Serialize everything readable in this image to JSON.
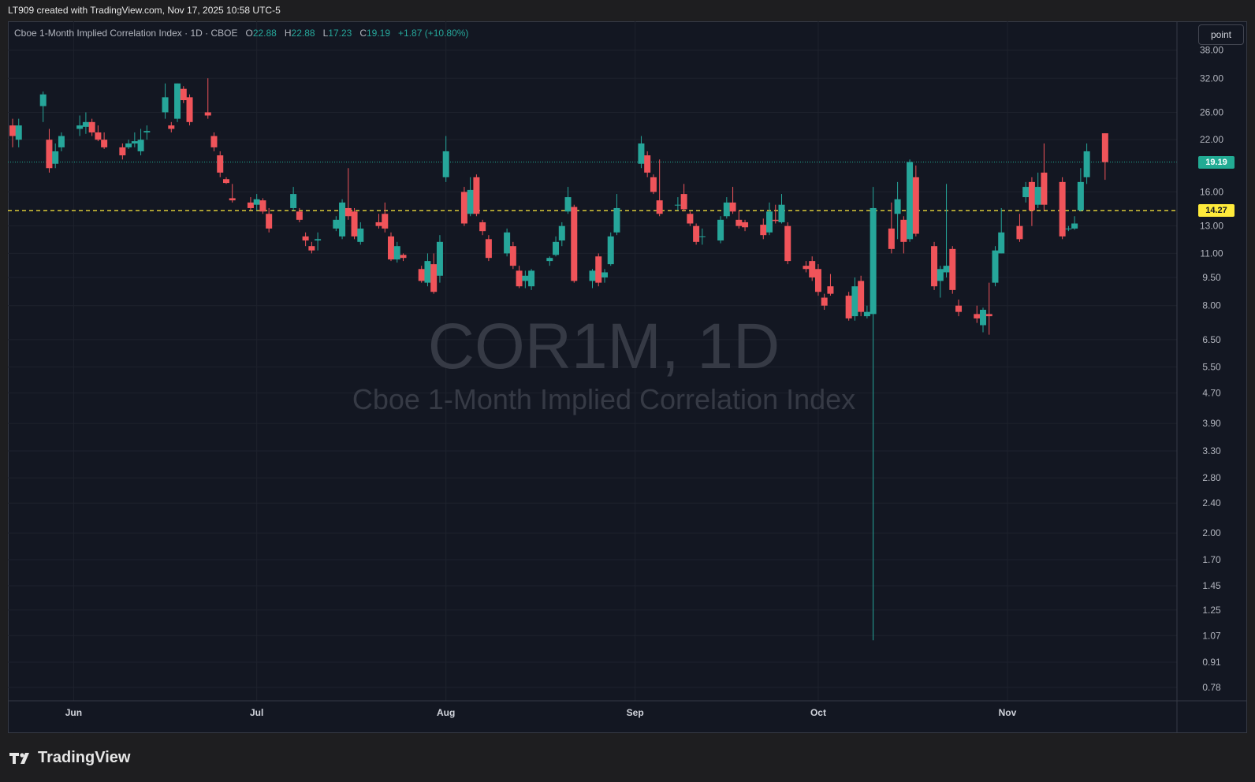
{
  "header": {
    "attribution": "LT909 created with TradingView.com, Nov 17, 2025 10:58 UTC-5"
  },
  "legend": {
    "title": "Cboe 1-Month Implied Correlation Index · 1D · CBOE",
    "open_label": "O",
    "open": "22.88",
    "high_label": "H",
    "high": "22.88",
    "low_label": "L",
    "low": "17.23",
    "close_label": "C",
    "close": "19.19",
    "change": "+1.87 (+10.80%)"
  },
  "toolbar": {
    "scale_button": "point"
  },
  "watermark": {
    "symbol": "COR1M, 1D",
    "description": "Cboe 1-Month Implied Correlation Index"
  },
  "brand": {
    "name": "TradingView",
    "logo_icon": "tradingview-logo-icon"
  },
  "price_tags": {
    "last": "19.19",
    "level": "14.27"
  },
  "colors": {
    "up": "#26a69a",
    "down": "#f0545a",
    "background": "#131722",
    "level_line": "#ffeb3b",
    "last_tag": "#22ab94"
  },
  "chart_data": {
    "type": "candlestick",
    "x_scale": "time",
    "y_scale": "log",
    "ylim": [
      0.74,
      44
    ],
    "xlim": [
      "2025-05-22",
      "2025-11-28"
    ],
    "y_ticks": [
      "38.00",
      "32.00",
      "26.00",
      "22.00",
      "16.00",
      "13.00",
      "11.00",
      "9.50",
      "8.00",
      "6.50",
      "5.50",
      "4.70",
      "3.90",
      "3.30",
      "2.80",
      "2.40",
      "2.00",
      "1.70",
      "1.45",
      "1.25",
      "1.07",
      "0.91",
      "0.78"
    ],
    "x_ticks": [
      {
        "date": "2025-06-01",
        "label": "Jun"
      },
      {
        "date": "2025-07-01",
        "label": "Jul"
      },
      {
        "date": "2025-08-01",
        "label": "Aug"
      },
      {
        "date": "2025-09-01",
        "label": "Sep"
      },
      {
        "date": "2025-10-01",
        "label": "Oct"
      },
      {
        "date": "2025-11-01",
        "label": "Nov"
      }
    ],
    "horizontal_line": 14.27,
    "last_price": 19.19,
    "candles": [
      {
        "d": "2025-05-22",
        "o": 24.0,
        "h": 25.0,
        "l": 21.0,
        "c": 22.5
      },
      {
        "d": "2025-05-23",
        "o": 22.0,
        "h": 25.0,
        "l": 21.0,
        "c": 24.0
      },
      {
        "d": "2025-05-27",
        "o": 27.0,
        "h": 29.5,
        "l": 24.5,
        "c": 29.0
      },
      {
        "d": "2025-05-28",
        "o": 22.0,
        "h": 23.5,
        "l": 18.0,
        "c": 18.5
      },
      {
        "d": "2025-05-29",
        "o": 19.0,
        "h": 21.5,
        "l": 18.5,
        "c": 20.5
      },
      {
        "d": "2025-05-30",
        "o": 21.0,
        "h": 23.0,
        "l": 20.5,
        "c": 22.5
      },
      {
        "d": "2025-06-02",
        "o": 23.5,
        "h": 25.5,
        "l": 22.5,
        "c": 24.0
      },
      {
        "d": "2025-06-03",
        "o": 23.8,
        "h": 26.0,
        "l": 22.8,
        "c": 24.5
      },
      {
        "d": "2025-06-04",
        "o": 24.5,
        "h": 25.0,
        "l": 22.5,
        "c": 23.0
      },
      {
        "d": "2025-06-05",
        "o": 23.0,
        "h": 24.0,
        "l": 21.8,
        "c": 22.0
      },
      {
        "d": "2025-06-06",
        "o": 22.0,
        "h": 23.0,
        "l": 20.8,
        "c": 21.0
      },
      {
        "d": "2025-06-09",
        "o": 21.0,
        "h": 21.5,
        "l": 19.5,
        "c": 20.0
      },
      {
        "d": "2025-06-10",
        "o": 21.0,
        "h": 22.0,
        "l": 20.8,
        "c": 21.5
      },
      {
        "d": "2025-06-11",
        "o": 21.5,
        "h": 23.0,
        "l": 21.0,
        "c": 21.8
      },
      {
        "d": "2025-06-12",
        "o": 20.5,
        "h": 23.5,
        "l": 20.0,
        "c": 22.0
      },
      {
        "d": "2025-06-13",
        "o": 23.0,
        "h": 24.0,
        "l": 22.0,
        "c": 23.2
      },
      {
        "d": "2025-06-16",
        "o": 26.0,
        "h": 31.0,
        "l": 25.0,
        "c": 28.5
      },
      {
        "d": "2025-06-17",
        "o": 24.0,
        "h": 24.5,
        "l": 23.0,
        "c": 23.5
      },
      {
        "d": "2025-06-18",
        "o": 25.0,
        "h": 31.0,
        "l": 24.5,
        "c": 31.0
      },
      {
        "d": "2025-06-19",
        "o": 30.0,
        "h": 30.5,
        "l": 27.5,
        "c": 28.0
      },
      {
        "d": "2025-06-20",
        "o": 28.5,
        "h": 29.0,
        "l": 24.0,
        "c": 24.5
      },
      {
        "d": "2025-06-23",
        "o": 26.0,
        "h": 32.0,
        "l": 25.0,
        "c": 25.5
      },
      {
        "d": "2025-06-24",
        "o": 22.5,
        "h": 23.0,
        "l": 20.5,
        "c": 21.0
      },
      {
        "d": "2025-06-25",
        "o": 20.0,
        "h": 20.5,
        "l": 17.5,
        "c": 18.0
      },
      {
        "d": "2025-06-26",
        "o": 17.3,
        "h": 17.5,
        "l": 16.8,
        "c": 16.9
      },
      {
        "d": "2025-06-27",
        "o": 15.4,
        "h": 16.8,
        "l": 15.0,
        "c": 15.2
      },
      {
        "d": "2025-06-30",
        "o": 15.0,
        "h": 15.5,
        "l": 14.3,
        "c": 14.5
      },
      {
        "d": "2025-07-01",
        "o": 14.8,
        "h": 15.8,
        "l": 14.3,
        "c": 15.3
      },
      {
        "d": "2025-07-02",
        "o": 15.2,
        "h": 15.4,
        "l": 14.0,
        "c": 14.2
      },
      {
        "d": "2025-07-03",
        "o": 14.0,
        "h": 14.5,
        "l": 12.5,
        "c": 12.8
      },
      {
        "d": "2025-07-07",
        "o": 14.5,
        "h": 16.5,
        "l": 14.3,
        "c": 15.8
      },
      {
        "d": "2025-07-08",
        "o": 14.2,
        "h": 14.5,
        "l": 13.3,
        "c": 13.5
      },
      {
        "d": "2025-07-09",
        "o": 12.2,
        "h": 12.5,
        "l": 11.5,
        "c": 11.9
      },
      {
        "d": "2025-07-10",
        "o": 11.5,
        "h": 11.8,
        "l": 11.0,
        "c": 11.2
      },
      {
        "d": "2025-07-11",
        "o": 11.9,
        "h": 12.5,
        "l": 11.2,
        "c": 12.0
      },
      {
        "d": "2025-07-14",
        "o": 12.8,
        "h": 13.8,
        "l": 12.6,
        "c": 13.5
      },
      {
        "d": "2025-07-15",
        "o": 12.2,
        "h": 15.3,
        "l": 12.0,
        "c": 15.0
      },
      {
        "d": "2025-07-16",
        "o": 14.5,
        "h": 18.5,
        "l": 13.5,
        "c": 13.8
      },
      {
        "d": "2025-07-17",
        "o": 14.2,
        "h": 14.5,
        "l": 12.0,
        "c": 12.2
      },
      {
        "d": "2025-07-18",
        "o": 11.8,
        "h": 13.3,
        "l": 11.6,
        "c": 12.8
      },
      {
        "d": "2025-07-21",
        "o": 13.3,
        "h": 14.0,
        "l": 12.8,
        "c": 13.0
      },
      {
        "d": "2025-07-22",
        "o": 14.0,
        "h": 15.0,
        "l": 12.5,
        "c": 12.8
      },
      {
        "d": "2025-07-23",
        "o": 12.2,
        "h": 12.5,
        "l": 10.5,
        "c": 10.6
      },
      {
        "d": "2025-07-24",
        "o": 10.6,
        "h": 11.8,
        "l": 10.4,
        "c": 11.5
      },
      {
        "d": "2025-07-25",
        "o": 10.9,
        "h": 11.0,
        "l": 10.5,
        "c": 10.7
      },
      {
        "d": "2025-07-28",
        "o": 10.0,
        "h": 10.2,
        "l": 9.2,
        "c": 9.3
      },
      {
        "d": "2025-07-29",
        "o": 9.2,
        "h": 11.0,
        "l": 9.0,
        "c": 10.5
      },
      {
        "d": "2025-07-30",
        "o": 10.3,
        "h": 11.0,
        "l": 8.6,
        "c": 8.7
      },
      {
        "d": "2025-07-31",
        "o": 9.6,
        "h": 12.3,
        "l": 9.2,
        "c": 11.8
      },
      {
        "d": "2025-08-01",
        "o": 17.5,
        "h": 22.5,
        "l": 17.0,
        "c": 20.5
      },
      {
        "d": "2025-08-04",
        "o": 16.0,
        "h": 16.5,
        "l": 13.0,
        "c": 13.2
      },
      {
        "d": "2025-08-05",
        "o": 14.0,
        "h": 17.5,
        "l": 13.8,
        "c": 16.2
      },
      {
        "d": "2025-08-06",
        "o": 17.5,
        "h": 17.8,
        "l": 13.8,
        "c": 14.0
      },
      {
        "d": "2025-08-07",
        "o": 13.3,
        "h": 13.5,
        "l": 12.3,
        "c": 12.6
      },
      {
        "d": "2025-08-08",
        "o": 12.0,
        "h": 12.3,
        "l": 10.5,
        "c": 10.7
      },
      {
        "d": "2025-08-11",
        "o": 11.0,
        "h": 12.8,
        "l": 10.8,
        "c": 12.5
      },
      {
        "d": "2025-08-12",
        "o": 11.5,
        "h": 11.8,
        "l": 10.0,
        "c": 10.2
      },
      {
        "d": "2025-08-13",
        "o": 9.9,
        "h": 10.2,
        "l": 8.9,
        "c": 9.0
      },
      {
        "d": "2025-08-14",
        "o": 9.3,
        "h": 9.9,
        "l": 8.9,
        "c": 9.6
      },
      {
        "d": "2025-08-15",
        "o": 9.0,
        "h": 10.0,
        "l": 8.8,
        "c": 9.9
      },
      {
        "d": "2025-08-18",
        "o": 10.5,
        "h": 10.8,
        "l": 10.2,
        "c": 10.7
      },
      {
        "d": "2025-08-19",
        "o": 10.9,
        "h": 12.2,
        "l": 10.8,
        "c": 11.8
      },
      {
        "d": "2025-08-20",
        "o": 11.9,
        "h": 13.3,
        "l": 11.5,
        "c": 13.0
      },
      {
        "d": "2025-08-21",
        "o": 14.2,
        "h": 16.5,
        "l": 14.0,
        "c": 15.5
      },
      {
        "d": "2025-08-22",
        "o": 14.6,
        "h": 14.8,
        "l": 9.2,
        "c": 9.3
      },
      {
        "d": "2025-08-25",
        "o": 9.3,
        "h": 10.0,
        "l": 8.9,
        "c": 9.9
      },
      {
        "d": "2025-08-26",
        "o": 10.8,
        "h": 11.0,
        "l": 9.0,
        "c": 9.2
      },
      {
        "d": "2025-08-27",
        "o": 9.5,
        "h": 10.0,
        "l": 9.2,
        "c": 9.8
      },
      {
        "d": "2025-08-28",
        "o": 10.3,
        "h": 12.5,
        "l": 10.2,
        "c": 12.2
      },
      {
        "d": "2025-08-29",
        "o": 12.5,
        "h": 15.8,
        "l": 12.3,
        "c": 14.5
      },
      {
        "d": "2025-09-02",
        "o": 19.0,
        "h": 22.5,
        "l": 18.5,
        "c": 21.5
      },
      {
        "d": "2025-09-03",
        "o": 20.0,
        "h": 20.5,
        "l": 17.5,
        "c": 18.0
      },
      {
        "d": "2025-09-04",
        "o": 17.5,
        "h": 17.8,
        "l": 15.8,
        "c": 16.0
      },
      {
        "d": "2025-09-05",
        "o": 15.2,
        "h": 19.5,
        "l": 13.8,
        "c": 14.0
      },
      {
        "d": "2025-09-08",
        "o": 14.8,
        "h": 15.5,
        "l": 14.3,
        "c": 14.8
      },
      {
        "d": "2025-09-09",
        "o": 15.8,
        "h": 16.8,
        "l": 14.2,
        "c": 14.4
      },
      {
        "d": "2025-09-10",
        "o": 14.0,
        "h": 14.2,
        "l": 13.0,
        "c": 13.2
      },
      {
        "d": "2025-09-11",
        "o": 13.0,
        "h": 13.2,
        "l": 11.6,
        "c": 11.8
      },
      {
        "d": "2025-09-12",
        "o": 12.2,
        "h": 12.8,
        "l": 11.6,
        "c": 12.2
      },
      {
        "d": "2025-09-15",
        "o": 11.9,
        "h": 13.8,
        "l": 11.7,
        "c": 13.5
      },
      {
        "d": "2025-09-16",
        "o": 13.8,
        "h": 15.5,
        "l": 13.6,
        "c": 15.0
      },
      {
        "d": "2025-09-17",
        "o": 15.0,
        "h": 16.5,
        "l": 14.0,
        "c": 14.2
      },
      {
        "d": "2025-09-18",
        "o": 13.5,
        "h": 14.3,
        "l": 12.8,
        "c": 13.0
      },
      {
        "d": "2025-09-19",
        "o": 13.3,
        "h": 13.5,
        "l": 12.6,
        "c": 12.9
      },
      {
        "d": "2025-09-22",
        "o": 13.1,
        "h": 13.6,
        "l": 12.0,
        "c": 12.3
      },
      {
        "d": "2025-09-23",
        "o": 12.5,
        "h": 15.0,
        "l": 12.3,
        "c": 14.2
      },
      {
        "d": "2025-09-24",
        "o": 13.5,
        "h": 14.8,
        "l": 13.2,
        "c": 13.4
      },
      {
        "d": "2025-09-25",
        "o": 13.3,
        "h": 15.8,
        "l": 13.2,
        "c": 14.8
      },
      {
        "d": "2025-09-26",
        "o": 13.0,
        "h": 13.3,
        "l": 10.3,
        "c": 10.5
      },
      {
        "d": "2025-09-29",
        "o": 10.2,
        "h": 10.5,
        "l": 9.8,
        "c": 10.0
      },
      {
        "d": "2025-09-30",
        "o": 10.5,
        "h": 10.8,
        "l": 9.3,
        "c": 9.5
      },
      {
        "d": "2025-10-01",
        "o": 10.0,
        "h": 10.3,
        "l": 8.5,
        "c": 8.7
      },
      {
        "d": "2025-10-02",
        "o": 8.4,
        "h": 8.6,
        "l": 7.8,
        "c": 8.0
      },
      {
        "d": "2025-10-03",
        "o": 9.0,
        "h": 9.7,
        "l": 8.5,
        "c": 8.6
      },
      {
        "d": "2025-10-06",
        "o": 8.5,
        "h": 8.7,
        "l": 7.3,
        "c": 7.4
      },
      {
        "d": "2025-10-07",
        "o": 7.5,
        "h": 9.5,
        "l": 7.3,
        "c": 9.0
      },
      {
        "d": "2025-10-08",
        "o": 9.3,
        "h": 9.6,
        "l": 7.5,
        "c": 7.7
      },
      {
        "d": "2025-10-09",
        "o": 7.5,
        "h": 8.0,
        "l": 7.4,
        "c": 7.7
      },
      {
        "d": "2025-10-10",
        "o": 7.6,
        "h": 16.5,
        "l": 1.04,
        "c": 14.5
      },
      {
        "d": "2025-10-13",
        "o": 12.8,
        "h": 15.0,
        "l": 11.0,
        "c": 11.3
      },
      {
        "d": "2025-10-14",
        "o": 14.0,
        "h": 17.0,
        "l": 12.0,
        "c": 15.3
      },
      {
        "d": "2025-10-15",
        "o": 13.5,
        "h": 13.8,
        "l": 11.0,
        "c": 11.8
      },
      {
        "d": "2025-10-16",
        "o": 12.0,
        "h": 19.5,
        "l": 11.8,
        "c": 19.2
      },
      {
        "d": "2025-10-17",
        "o": 17.5,
        "h": 18.8,
        "l": 12.2,
        "c": 12.4
      },
      {
        "d": "2025-10-20",
        "o": 11.5,
        "h": 11.8,
        "l": 8.8,
        "c": 9.0
      },
      {
        "d": "2025-10-21",
        "o": 9.3,
        "h": 10.2,
        "l": 8.4,
        "c": 10.0
      },
      {
        "d": "2025-10-22",
        "o": 9.8,
        "h": 16.8,
        "l": 9.5,
        "c": 10.2
      },
      {
        "d": "2025-10-23",
        "o": 11.3,
        "h": 11.5,
        "l": 8.6,
        "c": 8.8
      },
      {
        "d": "2025-10-24",
        "o": 8.0,
        "h": 8.3,
        "l": 7.5,
        "c": 7.7
      },
      {
        "d": "2025-10-27",
        "o": 7.6,
        "h": 8.0,
        "l": 7.2,
        "c": 7.4
      },
      {
        "d": "2025-10-28",
        "o": 7.1,
        "h": 7.9,
        "l": 6.8,
        "c": 7.8
      },
      {
        "d": "2025-10-29",
        "o": 7.6,
        "h": 9.2,
        "l": 6.7,
        "c": 7.5
      },
      {
        "d": "2025-10-30",
        "o": 9.2,
        "h": 11.5,
        "l": 9.0,
        "c": 11.2
      },
      {
        "d": "2025-10-31",
        "o": 11.0,
        "h": 14.5,
        "l": 11.0,
        "c": 12.5
      },
      {
        "d": "2025-11-03",
        "o": 13.0,
        "h": 14.0,
        "l": 11.8,
        "c": 12.0
      },
      {
        "d": "2025-11-04",
        "o": 15.5,
        "h": 17.0,
        "l": 15.0,
        "c": 16.5
      },
      {
        "d": "2025-11-05",
        "o": 17.0,
        "h": 17.5,
        "l": 13.0,
        "c": 14.3
      },
      {
        "d": "2025-11-06",
        "o": 14.8,
        "h": 18.0,
        "l": 14.5,
        "c": 16.5
      },
      {
        "d": "2025-11-07",
        "o": 18.0,
        "h": 21.5,
        "l": 14.3,
        "c": 14.8
      },
      {
        "d": "2025-11-10",
        "o": 17.0,
        "h": 17.5,
        "l": 12.0,
        "c": 12.2
      },
      {
        "d": "2025-11-11",
        "o": 12.8,
        "h": 13.0,
        "l": 12.6,
        "c": 12.8
      },
      {
        "d": "2025-11-12",
        "o": 12.8,
        "h": 13.8,
        "l": 12.7,
        "c": 13.2
      },
      {
        "d": "2025-11-13",
        "o": 14.3,
        "h": 18.5,
        "l": 14.2,
        "c": 17.0
      },
      {
        "d": "2025-11-14",
        "o": 17.5,
        "h": 21.5,
        "l": 16.8,
        "c": 20.5
      },
      {
        "d": "2025-11-17",
        "o": 22.88,
        "h": 22.88,
        "l": 17.23,
        "c": 19.19
      }
    ]
  }
}
